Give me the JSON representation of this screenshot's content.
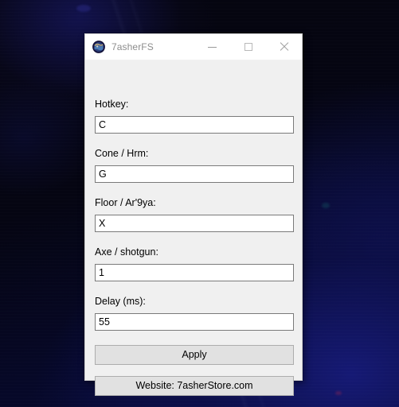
{
  "window": {
    "title": "7asherFS",
    "icon": "app-globe-icon",
    "caption_buttons": [
      {
        "name": "minimize",
        "glyph": "minimize-icon"
      },
      {
        "name": "maximize",
        "glyph": "maximize-icon"
      },
      {
        "name": "close",
        "glyph": "close-icon"
      }
    ]
  },
  "form": {
    "fields": [
      {
        "label": "Hotkey:",
        "value": "C",
        "name": "hotkey"
      },
      {
        "label": "Cone / Hrm:",
        "value": "G",
        "name": "cone-hrm"
      },
      {
        "label": "Floor / Ar'9ya:",
        "value": "X",
        "name": "floor-ar9ya"
      },
      {
        "label": "Axe / shotgun:",
        "value": "1",
        "name": "axe-shotgun"
      },
      {
        "label": "Delay (ms):",
        "value": "55",
        "name": "delay-ms"
      }
    ],
    "apply_label": "Apply",
    "website_label": "Website: 7asherStore.com"
  },
  "colors": {
    "window_background": "#f0f0f0",
    "title_bar": "#ffffff",
    "button_face": "#e1e1e1",
    "button_border": "#adadad",
    "input_border": "#7a7a7a",
    "title_text": "#8d8d8d",
    "desktop": "#05050e"
  }
}
